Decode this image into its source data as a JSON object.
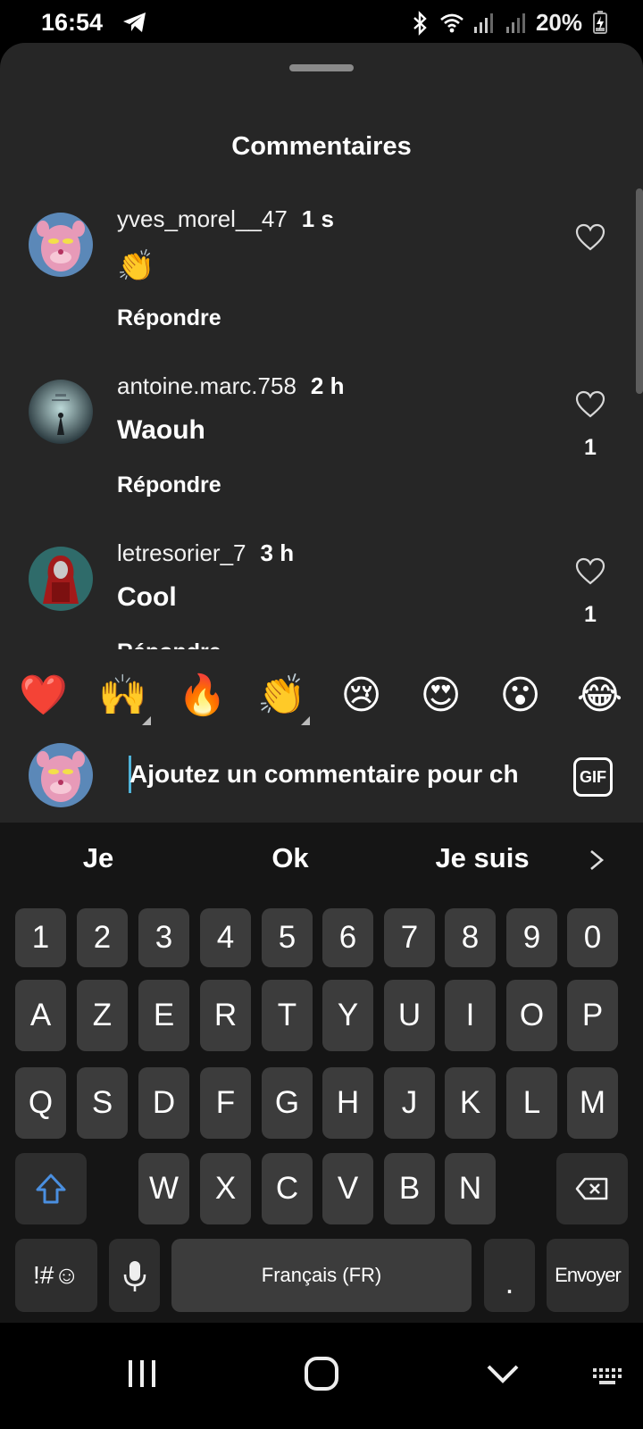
{
  "status_bar": {
    "time": "16:54",
    "battery": "20%"
  },
  "sheet": {
    "title": "Commentaires"
  },
  "comments": [
    {
      "username": "yves_morel__47",
      "time": "1 s",
      "text": "👏",
      "reply": "Répondre",
      "likes": ""
    },
    {
      "username": "antoine.marc.758",
      "time": "2 h",
      "text": "Waouh",
      "reply": "Répondre",
      "likes": "1"
    },
    {
      "username": "letresorier_7",
      "time": "3 h",
      "text": "Cool",
      "reply": "Répondre",
      "likes": "1"
    }
  ],
  "reactions": [
    "❤️",
    "🙌",
    "🔥",
    "👏",
    "😢",
    "😍",
    "😮",
    "😂"
  ],
  "composer": {
    "placeholder": "Ajoutez un commentaire pour ch",
    "gif_label": "GIF"
  },
  "keyboard": {
    "suggestions": [
      "Je",
      "Ok",
      "Je suis"
    ],
    "row_numbers": [
      "1",
      "2",
      "3",
      "4",
      "5",
      "6",
      "7",
      "8",
      "9",
      "0"
    ],
    "row1": [
      "A",
      "Z",
      "E",
      "R",
      "T",
      "Y",
      "U",
      "I",
      "O",
      "P"
    ],
    "row2": [
      "Q",
      "S",
      "D",
      "F",
      "G",
      "H",
      "J",
      "K",
      "L",
      "M"
    ],
    "row3": [
      "W",
      "X",
      "C",
      "V",
      "B",
      "N"
    ],
    "symbols_label": "!#☺",
    "space_label": "Français (FR)",
    "period_label": ".",
    "send_label": "Envoyer"
  },
  "colors": {
    "sheet_bg": "#262626",
    "key_bg": "#3c3c3c",
    "shift_blue": "#4a8fe0"
  }
}
